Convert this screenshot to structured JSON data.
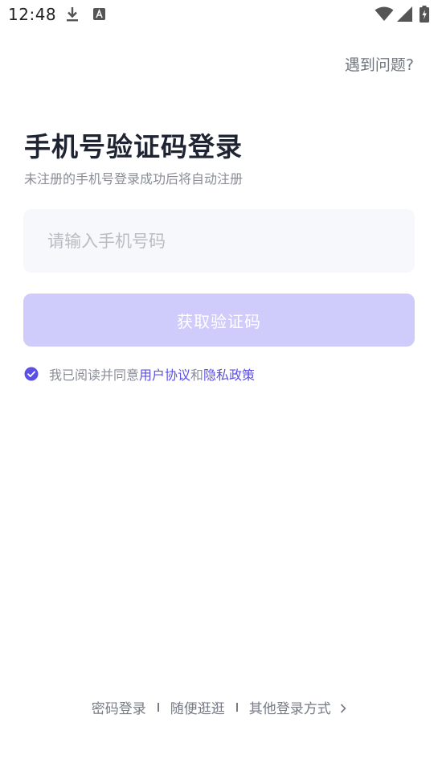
{
  "status_bar": {
    "time": "12:48",
    "icons": [
      "download-icon",
      "font-a-icon",
      "wifi-icon",
      "signal-icon",
      "battery-charging-icon"
    ]
  },
  "header": {
    "help_label": "遇到问题?"
  },
  "login": {
    "title": "手机号验证码登录",
    "subtitle": "未注册的手机号登录成功后将自动注册",
    "phone_placeholder": "请输入手机号码",
    "phone_value": "",
    "get_code_label": "获取验证码"
  },
  "agreement": {
    "checked": true,
    "prefix": "我已阅读并同意",
    "user_agreement": "用户协议",
    "connector": "和",
    "privacy_policy": "隐私政策"
  },
  "footer": {
    "password_login": "密码登录",
    "browse": "随便逛逛",
    "other_login": "其他登录方式"
  },
  "colors": {
    "accent": "#5b4fe6",
    "button_disabled": "#cfccfb",
    "input_bg": "#f7f8fb",
    "title": "#1f2433",
    "muted": "#8a8d96"
  }
}
